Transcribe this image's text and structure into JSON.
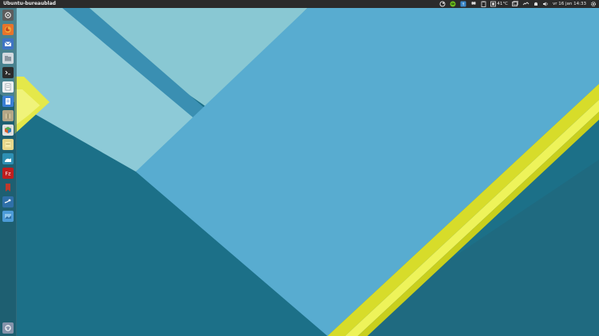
{
  "window": {
    "title": "Ubuntu-bureaublad"
  },
  "panel": {
    "temperature": "41°C",
    "datetime": "vr 16 jan 14:33"
  },
  "launcher": {
    "items": [
      {
        "name": "dash-home-icon",
        "color": "#6d6d6d"
      },
      {
        "name": "firefox-icon",
        "color": "#e8742b"
      },
      {
        "name": "thunderbird-mail-icon",
        "color": "#5a8fd6"
      },
      {
        "name": "files-icon",
        "color": "#cfd6dc"
      },
      {
        "name": "terminal-icon",
        "color": "#2a2a2a"
      },
      {
        "name": "text-editor-icon",
        "color": "#e9ecef"
      },
      {
        "name": "libreoffice-writer-icon",
        "color": "#3a7fd4"
      },
      {
        "name": "archive-manager-icon",
        "color": "#b3a586"
      },
      {
        "name": "software-center-icon",
        "color": "#d85c2b"
      },
      {
        "name": "notes-icon",
        "color": "#e6d68a"
      },
      {
        "name": "seahorse-icon",
        "color": "#2e8fb3"
      },
      {
        "name": "filezilla-icon",
        "color": "#bf1e1e"
      },
      {
        "name": "bookmark-app-icon",
        "color": "#c0392b"
      },
      {
        "name": "steam-icon",
        "color": "#2f6fa8"
      },
      {
        "name": "photos-icon",
        "color": "#4c9bd8"
      },
      {
        "name": "trash-icon",
        "color": "#6b7d99"
      }
    ]
  },
  "colors": {
    "background": "#1a6f86",
    "panel": "#2b2b2b",
    "wall_light": "#5fb3cf",
    "wall_pale": "#8ccbd6",
    "accent_yellow": "#e2e51f"
  }
}
